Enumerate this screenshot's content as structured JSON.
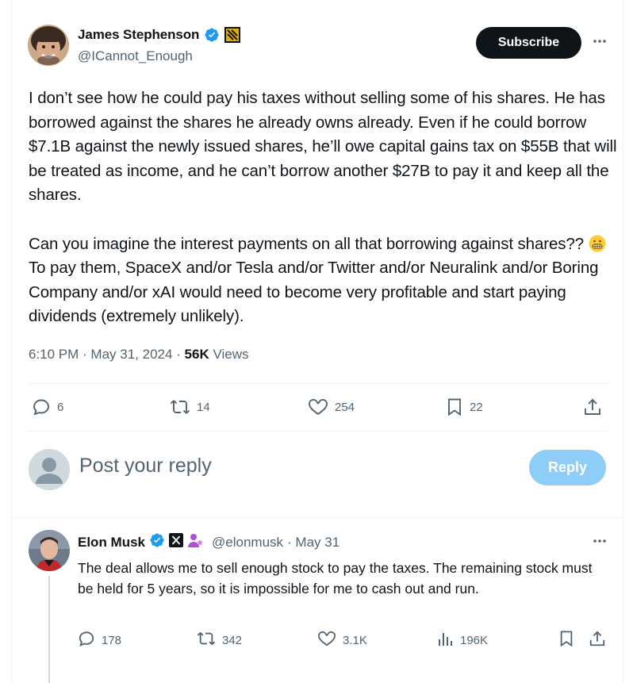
{
  "main_tweet": {
    "author_name": "James Stephenson",
    "author_handle": "@ICannot_Enough",
    "subscribe_label": "Subscribe",
    "paragraph1": "I don’t see how he could pay his taxes without selling some of his shares. He has borrowed against the shares he already owns already.  Even if he could borrow $7.1B against the newly issued shares, he’ll owe capital gains tax on $55B that will be treated as income, and he can’t borrow another $27B to pay it and keep all the shares.",
    "paragraph2_before_emoji": "Can you imagine the interest payments on all that borrowing against shares?? ",
    "paragraph2_after_emoji": " To pay them, SpaceX and/or Tesla and/or Twitter and/or Neuralink and/or Boring Company and/or xAI would need to become very profitable and start paying dividends (extremely unlikely).",
    "timestamp": "6:10 PM · May 31, 2024 · ",
    "views_count": "56K",
    "views_label": " Views",
    "actions": {
      "replies": "6",
      "reposts": "14",
      "likes": "254",
      "bookmarks": "22"
    },
    "icons": [
      "verified-badge-icon",
      "affiliate-badge-icon",
      "more-icon",
      "reply-icon",
      "repost-icon",
      "like-icon",
      "bookmark-icon",
      "share-icon"
    ]
  },
  "composer": {
    "placeholder": "Post your reply",
    "reply_button": "Reply"
  },
  "reply_tweet": {
    "author_name": "Elon Musk",
    "author_handle": "@elonmusk",
    "date": " · May 31",
    "text": "The deal allows me to sell enough stock to pay the taxes. The remaining stock must be held for 5 years, so it is impossible for me to cash out and run.",
    "actions": {
      "replies": "178",
      "reposts": "342",
      "likes": "3.1K",
      "views": "196K"
    }
  },
  "colors": {
    "primary_text": "#0f1419",
    "secondary_text": "#536471",
    "verified_blue": "#1d9bf0",
    "reply_button_disabled": "#8ecdf8",
    "divider": "#eff3f4"
  }
}
